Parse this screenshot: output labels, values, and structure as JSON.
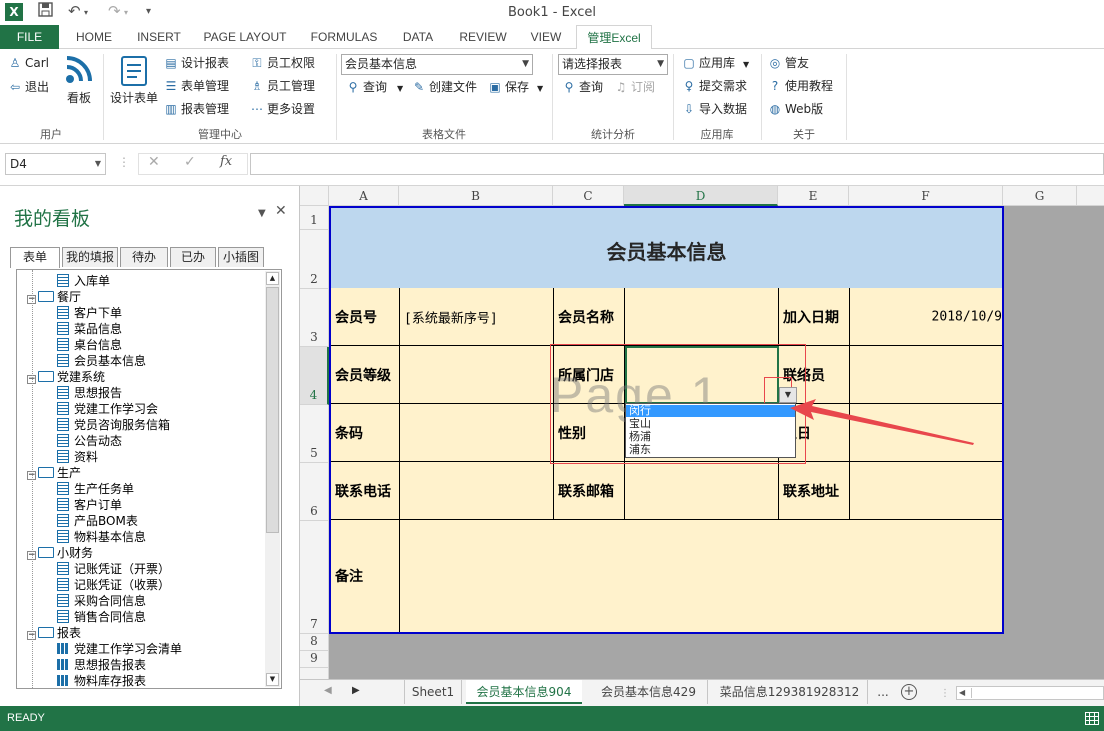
{
  "window": {
    "title": "Book1 - Excel"
  },
  "tabs": [
    "FILE",
    "HOME",
    "INSERT",
    "PAGE LAYOUT",
    "FORMULAS",
    "DATA",
    "REVIEW",
    "VIEW",
    "管理Excel"
  ],
  "ribbon": {
    "user": {
      "name": "Carl",
      "logout": "退出",
      "group": "用户"
    },
    "kanban": "看板",
    "design_form": "设计表单",
    "manage": {
      "design_report": "设计报表",
      "form_manage": "表单管理",
      "report_manage": "报表管理",
      "staff_perm": "员工权限",
      "staff_manage": "员工管理",
      "more_settings": "更多设置",
      "group": "管理中心"
    },
    "form_file": {
      "combo_value": "会员基本信息",
      "query": "查询",
      "create_file": "创建文件",
      "save": "保存",
      "group": "表格文件"
    },
    "stats": {
      "combo_placeholder": "请选择报表",
      "query": "查询",
      "subscribe": "订阅",
      "group": "统计分析"
    },
    "app": {
      "library": "应用库",
      "submit": "提交需求",
      "import": "导入数据",
      "group": "应用库"
    },
    "about": {
      "guanyou": "管友",
      "tutorial": "使用教程",
      "web": "Web版",
      "group": "关于"
    }
  },
  "formula_bar": {
    "name_box": "D4",
    "formula": ""
  },
  "panel": {
    "title": "我的看板",
    "tabs": [
      "表单",
      "我的填报",
      "待办",
      "已办",
      "小插图"
    ],
    "tree": [
      {
        "label": "入库单",
        "kind": "doc",
        "level": 2
      },
      {
        "label": "餐厅",
        "kind": "folder",
        "level": 1
      },
      {
        "label": "客户下单",
        "kind": "doc",
        "level": 2
      },
      {
        "label": "菜品信息",
        "kind": "doc",
        "level": 2
      },
      {
        "label": "桌台信息",
        "kind": "doc",
        "level": 2
      },
      {
        "label": "会员基本信息",
        "kind": "doc",
        "level": 2
      },
      {
        "label": "党建系统",
        "kind": "folder",
        "level": 1
      },
      {
        "label": "思想报告",
        "kind": "doc",
        "level": 2
      },
      {
        "label": "党建工作学习会",
        "kind": "doc",
        "level": 2
      },
      {
        "label": "党员咨询服务信箱",
        "kind": "doc",
        "level": 2
      },
      {
        "label": "公告动态",
        "kind": "doc",
        "level": 2
      },
      {
        "label": "资料",
        "kind": "doc",
        "level": 2
      },
      {
        "label": "生产",
        "kind": "folder",
        "level": 1
      },
      {
        "label": "生产任务单",
        "kind": "doc",
        "level": 2
      },
      {
        "label": "客户订单",
        "kind": "doc",
        "level": 2
      },
      {
        "label": "产品BOM表",
        "kind": "doc",
        "level": 2
      },
      {
        "label": "物料基本信息",
        "kind": "doc",
        "level": 2
      },
      {
        "label": "小财务",
        "kind": "folder",
        "level": 1
      },
      {
        "label": "记账凭证（开票）",
        "kind": "doc",
        "level": 2
      },
      {
        "label": "记账凭证（收票）",
        "kind": "doc",
        "level": 2
      },
      {
        "label": "采购合同信息",
        "kind": "doc",
        "level": 2
      },
      {
        "label": "销售合同信息",
        "kind": "doc",
        "level": 2
      },
      {
        "label": "报表",
        "kind": "folder",
        "level": 1
      },
      {
        "label": "党建工作学习会清单",
        "kind": "report",
        "level": 2
      },
      {
        "label": "思想报告报表",
        "kind": "report",
        "level": 2
      },
      {
        "label": "物料库存报表",
        "kind": "report",
        "level": 2
      }
    ]
  },
  "sheet": {
    "columns": [
      "A",
      "B",
      "C",
      "D",
      "E",
      "F",
      "G"
    ],
    "rows": [
      "1",
      "2",
      "3",
      "4",
      "5",
      "6",
      "7",
      "8",
      "9"
    ],
    "form_title": "会员基本信息",
    "labels": {
      "member_no": "会员号",
      "member_no_value": "[系统最新序号]",
      "member_name": "会员名称",
      "join_date": "加入日期",
      "join_date_value": "2018/10/9",
      "member_level": "会员等级",
      "store": "所属门店",
      "liaison": "联络员",
      "barcode": "条码",
      "gender": "性别",
      "birthday": "生日",
      "phone": "联系电话",
      "email": "联系邮箱",
      "address": "联系地址",
      "remark": "备注"
    },
    "watermark": "Page 1",
    "dropdown_options": [
      "闵行",
      "宝山",
      "杨浦",
      "浦东"
    ],
    "dropdown_selected": "闵行"
  },
  "sheet_tabs": [
    "Sheet1",
    "会员基本信息904",
    "会员基本信息429",
    "菜品信息129381928312",
    "..."
  ],
  "active_sheet": "会员基本信息904",
  "status": "READY",
  "colors": {
    "excel_green": "#217346",
    "form_fill": "#fff2cc",
    "title_fill": "#bdd7ee",
    "form_border": "#0000cc",
    "highlight": "#e8474c"
  }
}
